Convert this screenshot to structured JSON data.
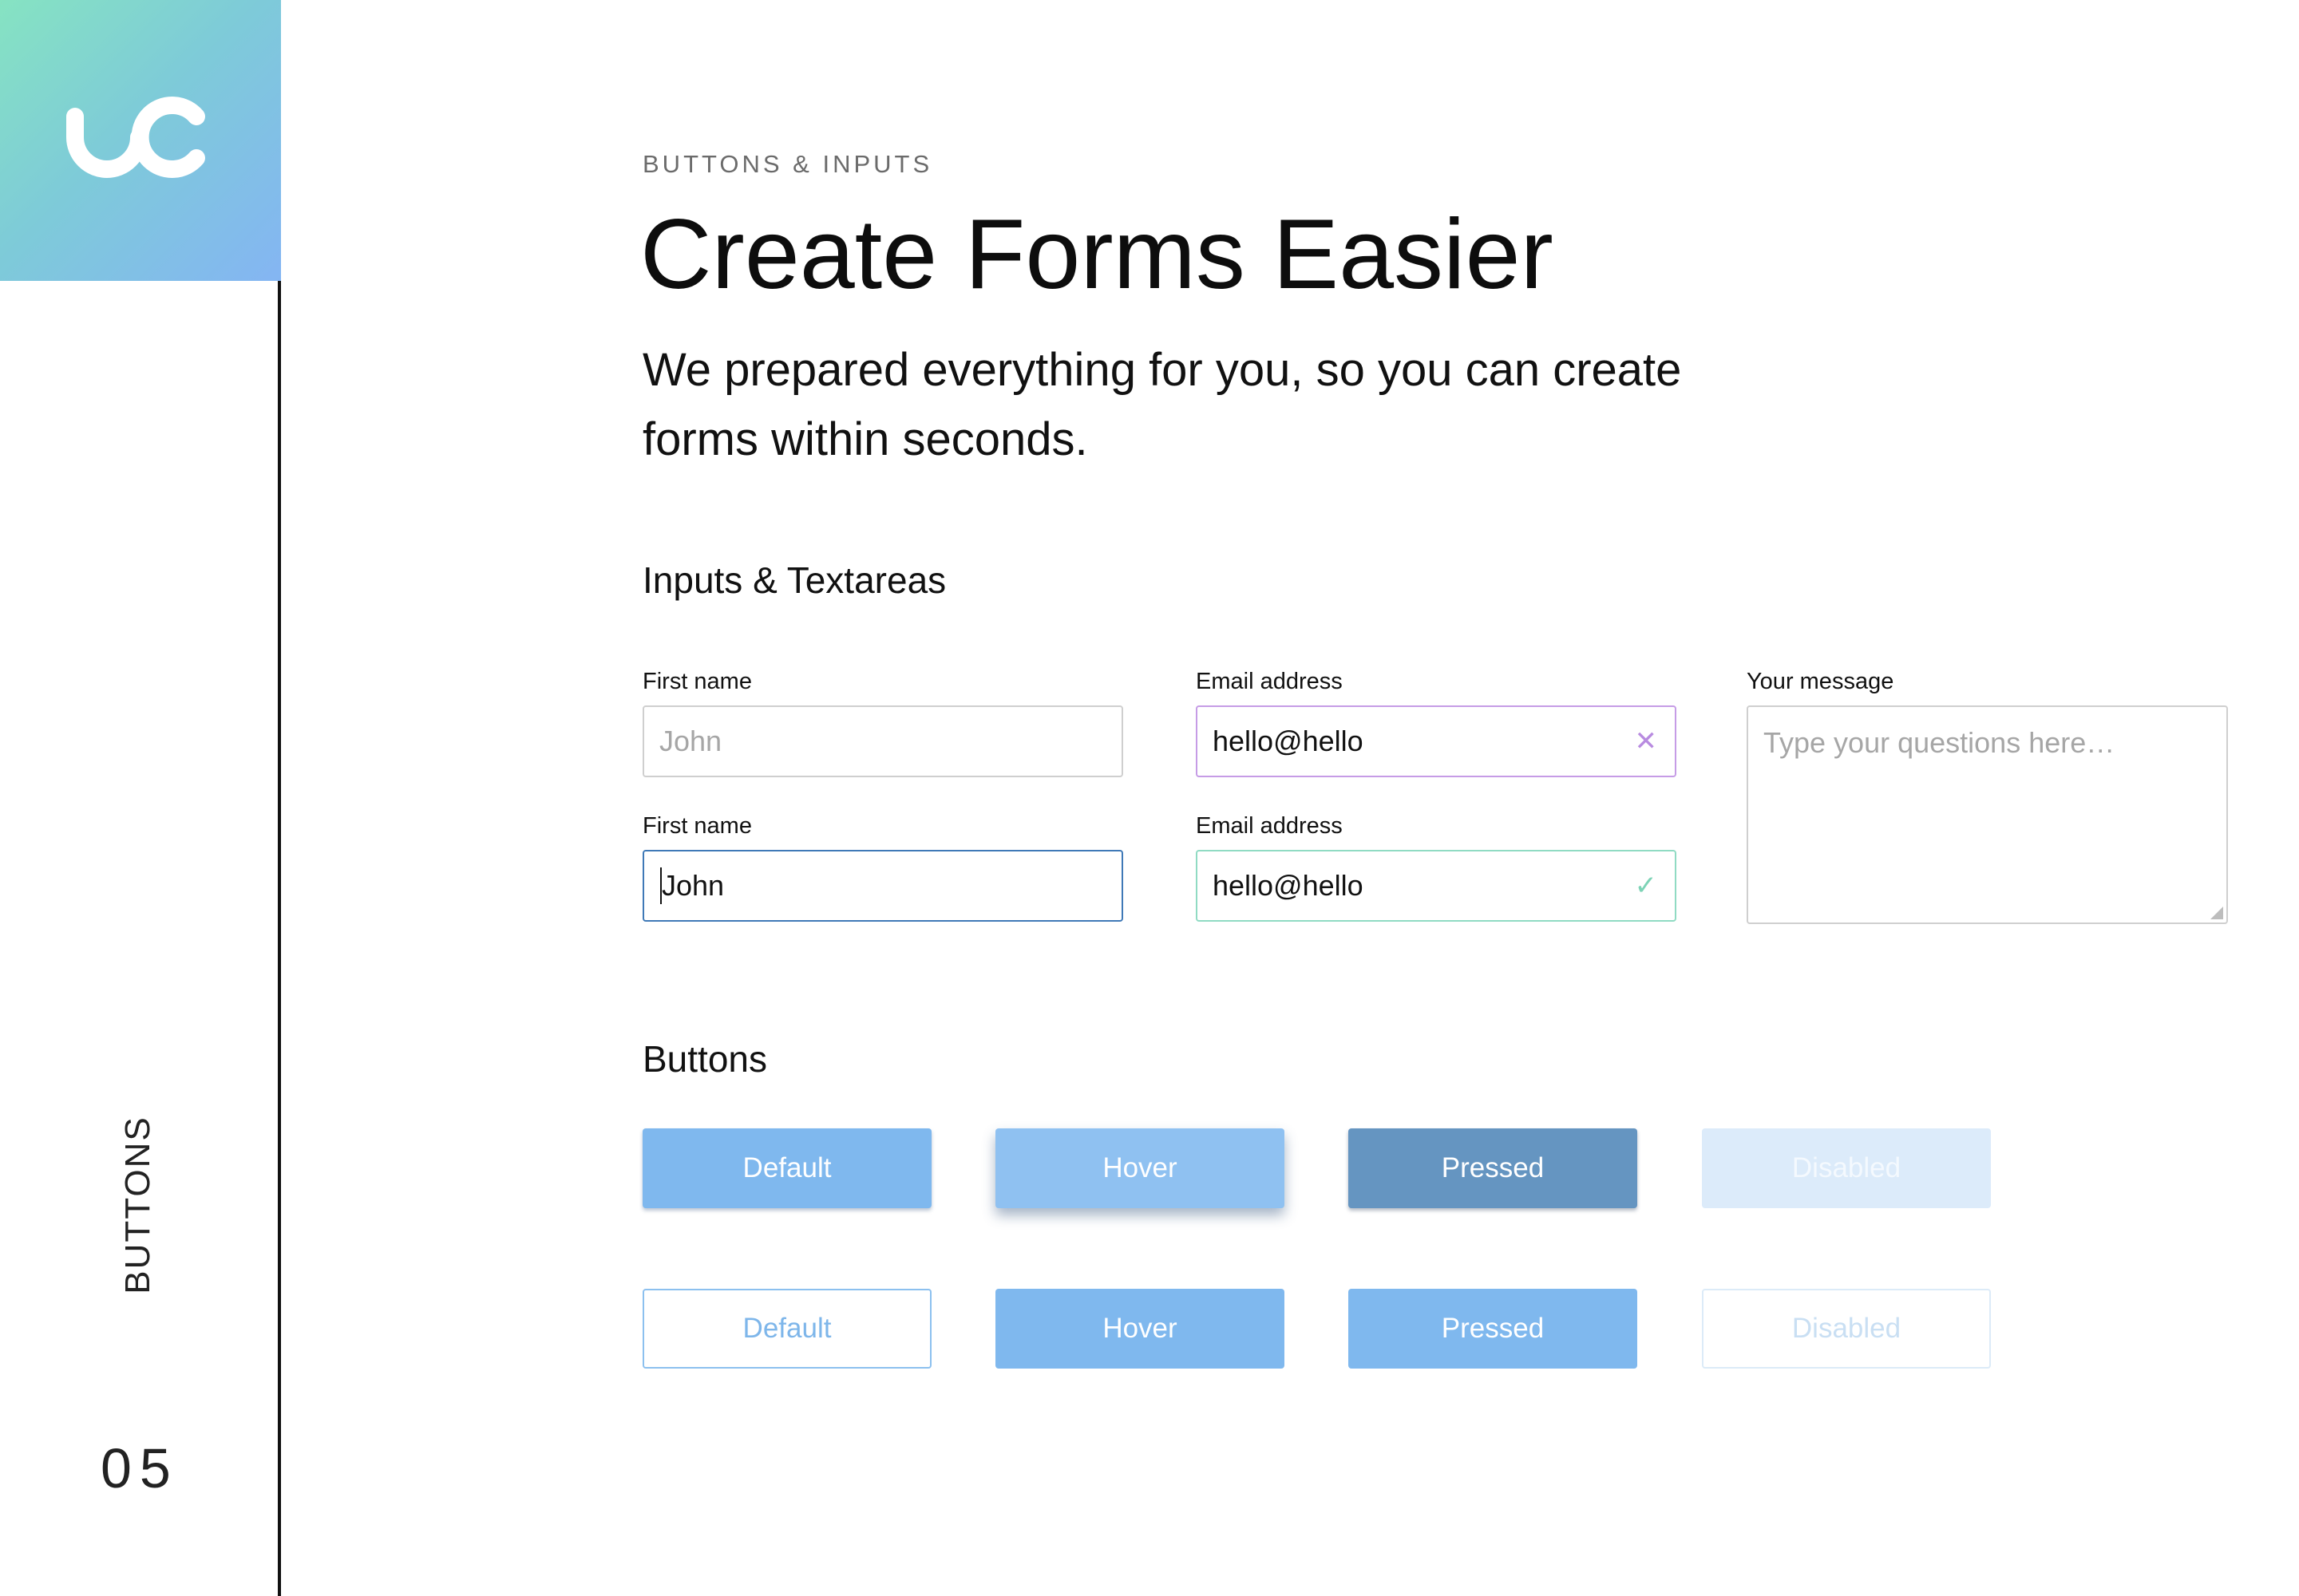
{
  "sidebar": {
    "section_label": "BUTTONS",
    "page_number": "05"
  },
  "header": {
    "eyebrow": "BUTTONS & INPUTS",
    "title": "Create Forms Easier",
    "subtitle": "We prepared everything for you, so you can create forms within seconds."
  },
  "inputs_section": {
    "title": "Inputs & Textareas",
    "fields": [
      {
        "label": "First name",
        "placeholder": "John",
        "value": "",
        "state": "default"
      },
      {
        "label": "Email address",
        "value": "hello@hello",
        "state": "error",
        "icon": "close-icon"
      },
      {
        "label": "First name",
        "value": "John",
        "state": "focused"
      },
      {
        "label": "Email address",
        "value": "hello@hello",
        "state": "success",
        "icon": "check-icon"
      }
    ],
    "textarea": {
      "label": "Your message",
      "placeholder": "Type your questions here…"
    }
  },
  "buttons_section": {
    "title": "Buttons",
    "solid": [
      {
        "label": "Default",
        "state": "default"
      },
      {
        "label": "Hover",
        "state": "hover"
      },
      {
        "label": "Pressed",
        "state": "pressed"
      },
      {
        "label": "Disabled",
        "state": "disabled"
      }
    ],
    "outline": [
      {
        "label": "Default",
        "state": "default"
      },
      {
        "label": "Hover",
        "state": "hover"
      },
      {
        "label": "Pressed",
        "state": "pressed"
      },
      {
        "label": "Disabled",
        "state": "disabled"
      }
    ]
  },
  "icons": {
    "error": "✕",
    "success": "✓"
  },
  "colors": {
    "accent": "#7fb8ee",
    "focus": "#3f79b7",
    "error": "#c69ce6",
    "success": "#90dbc3"
  }
}
